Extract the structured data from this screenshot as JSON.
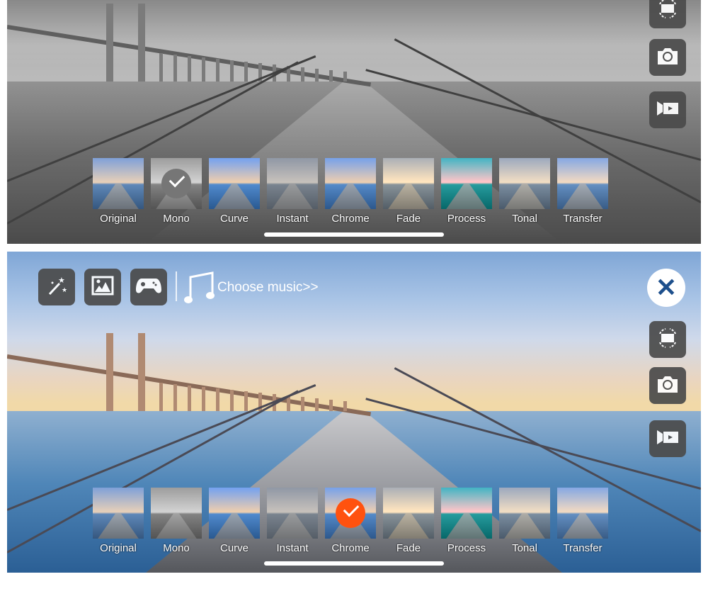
{
  "filters": [
    {
      "label": "Original"
    },
    {
      "label": "Mono"
    },
    {
      "label": "Curve"
    },
    {
      "label": "Instant"
    },
    {
      "label": "Chrome"
    },
    {
      "label": "Fade"
    },
    {
      "label": "Process"
    },
    {
      "label": "Tonal"
    },
    {
      "label": "Transfer"
    }
  ],
  "top_panel": {
    "selected_filter": "Mono",
    "mode": "grayscale"
  },
  "bottom_panel": {
    "selected_filter": "Chrome",
    "music_label": "Choose music>>"
  },
  "icons": {
    "toolbar": [
      "magic-wand-icon",
      "image-icon",
      "gamepad-icon",
      "music-note-icon"
    ],
    "side": [
      "close-icon",
      "rotate-screen-icon",
      "camera-icon",
      "video-camera-icon"
    ]
  },
  "colors": {
    "accent": "#ee5a27",
    "close_icon": "#1d4f8c",
    "button_bg": "#4b4b4b"
  }
}
